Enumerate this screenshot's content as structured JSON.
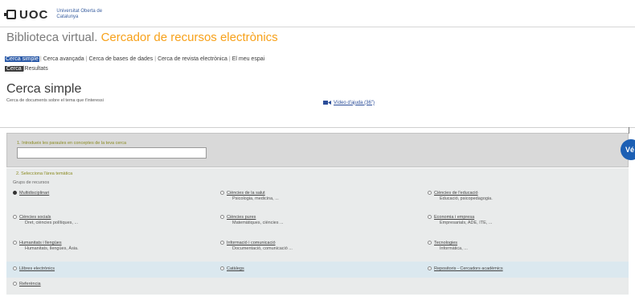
{
  "header": {
    "logo_text": "UOC",
    "university": "Universitat Oberta de Catalunya"
  },
  "title": {
    "part1": "Biblioteca virtual.",
    "part2": "Cercador de recursos electrònics"
  },
  "tabs": [
    "Cerca simple",
    "Cerca avançada",
    "Cerca de bases de dades",
    "Cerca de revista electrònica",
    "El meu espai"
  ],
  "subtabs": [
    "Cerca",
    "Resultats"
  ],
  "page": {
    "heading": "Cerca simple",
    "description": "Cerca de documents sobre el tema que t'interessi",
    "video_link": "Vídeo d'ajuda (36\")"
  },
  "step1": {
    "label": "1. Introdueix les paraules en conceptes de la teva cerca",
    "value": ""
  },
  "help_button": "Vé",
  "step2": {
    "label": "2. Selecciona l'àrea temàtica",
    "group_label": "Grups de recursos"
  },
  "options": [
    {
      "name": "Multidisciplinari",
      "sub": "",
      "selected": true
    },
    {
      "name": "Ciències de la salut",
      "sub": "Psicologia, medicina, ...",
      "selected": false
    },
    {
      "name": "Ciències de l'educació",
      "sub": "Educació, psicopedagogia.",
      "selected": false
    },
    {
      "name": "Ciències socials",
      "sub": "Dret, ciències polítiques, ...",
      "selected": false
    },
    {
      "name": "Ciències pures",
      "sub": "Matemàtiques, ciències ...",
      "selected": false
    },
    {
      "name": "Economia i empresa",
      "sub": "Empresarials, ADE, ITE, ...",
      "selected": false
    },
    {
      "name": "Humanitats i llengües",
      "sub": "Humanitats, llengües, Àsia.",
      "selected": false
    },
    {
      "name": "Informació i comunicació",
      "sub": "Documentació, comunicació ...",
      "selected": false
    },
    {
      "name": "Tecnologies",
      "sub": "Informàtica, ...",
      "selected": false
    },
    {
      "name": "Llibres electrònics",
      "sub": "",
      "selected": false
    },
    {
      "name": "Catàlegs",
      "sub": "",
      "selected": false
    },
    {
      "name": "Repositoris - Cercadors acadèmics",
      "sub": "",
      "selected": false
    },
    {
      "name": "Referència",
      "sub": "",
      "selected": false
    }
  ]
}
